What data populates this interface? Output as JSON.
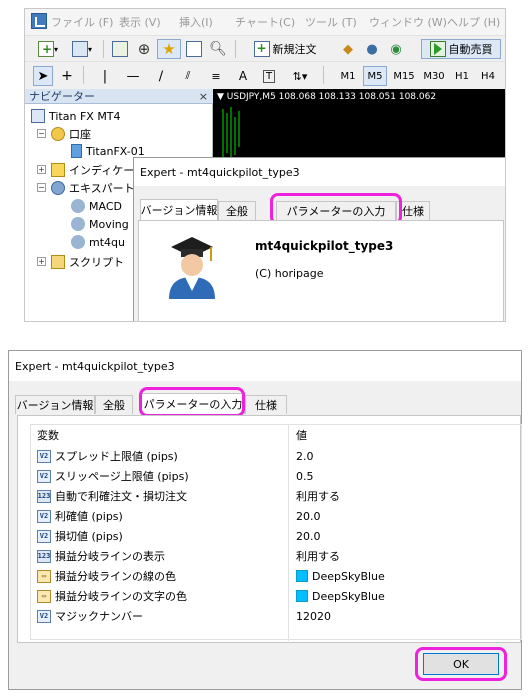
{
  "top": {
    "menu": [
      "ファイル (F)",
      "表示 (V)",
      "挿入(I)",
      "チャート(C)",
      "ツール (T)",
      "ウィンドウ (W)",
      "ヘルプ (H)"
    ],
    "toolbar": {
      "new_order": "新規注文",
      "auto_trade": "自動売買"
    },
    "timeframes": [
      "M1",
      "M5",
      "M15",
      "M30",
      "H1",
      "H4"
    ],
    "navigator": {
      "title": "ナビゲーター",
      "close": "×",
      "items": [
        "Titan FX MT4",
        "口座",
        "TitanFX-01",
        "インディケータ",
        "エキスパートアドバイザ",
        "MACD",
        "Moving",
        "mt4qu",
        "スクリプト"
      ]
    },
    "chart": {
      "symbol_line": "▼ USDJPY,M5  108.068 108.133 108.051 108.062"
    },
    "dialog": {
      "title": "Expert - mt4quickpilot_type3",
      "tabs": [
        "バージョン情報",
        "全般",
        "パラメーターの入力",
        "仕様"
      ],
      "ea_name": "mt4quickpilot_type3",
      "copyright": "(C) horipage"
    }
  },
  "bottom": {
    "title": "Expert - mt4quickpilot_type3",
    "tabs": [
      "バージョン情報",
      "全般",
      "パラメーターの入力",
      "仕様"
    ],
    "columns": {
      "variable": "変数",
      "value": "値"
    },
    "params": [
      {
        "icon": "V2",
        "name": "スプレッド上限値 (pips)",
        "value": "2.0"
      },
      {
        "icon": "V2",
        "name": "スリッページ上限値 (pips)",
        "value": "0.5"
      },
      {
        "icon": "123",
        "name": "自動で利確注文・損切注文",
        "value": "利用する"
      },
      {
        "icon": "V2",
        "name": "利確値 (pips)",
        "value": "20.0"
      },
      {
        "icon": "V2",
        "name": "損切値 (pips)",
        "value": "20.0"
      },
      {
        "icon": "123",
        "name": "損益分岐ラインの表示",
        "value": "利用する"
      },
      {
        "icon": "color",
        "name": "損益分岐ラインの線の色",
        "value": "DeepSkyBlue"
      },
      {
        "icon": "color",
        "name": "損益分岐ラインの文字の色",
        "value": "DeepSkyBlue"
      },
      {
        "icon": "V2",
        "name": "マジックナンバー",
        "value": "12020"
      }
    ],
    "ok": "OK"
  },
  "colors": {
    "highlight": "#ee22dd",
    "deepskyblue": "#00bfff"
  }
}
